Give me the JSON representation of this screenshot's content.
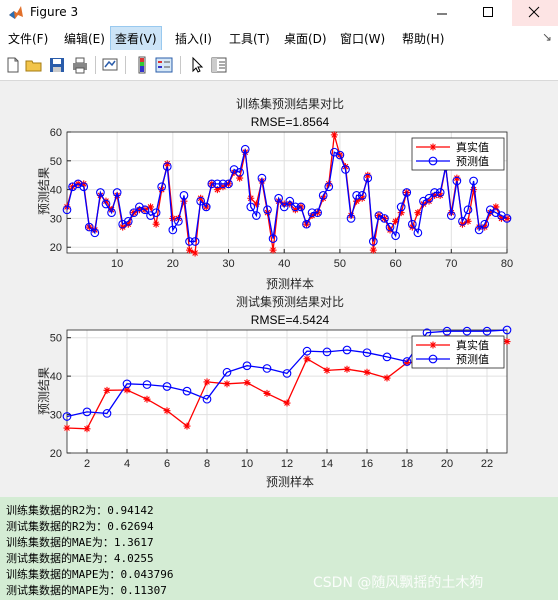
{
  "window": {
    "title": "Figure 3"
  },
  "menu": [
    "文件(F)",
    "编辑(E)",
    "查看(V)",
    "插入(I)",
    "工具(T)",
    "桌面(D)",
    "窗口(W)",
    "帮助(H)"
  ],
  "toolbar_icons": [
    "new-figure-icon",
    "open-file-icon",
    "save-icon",
    "print-icon",
    "link-plot-icon",
    "insert-colorbar-icon",
    "insert-legend-icon",
    "pointer-icon",
    "property-inspector-icon"
  ],
  "chart_data": [
    {
      "type": "line",
      "title": "训练集预测结果对比",
      "subtitle": "RMSE=1.8564",
      "xlabel": "预测样本",
      "ylabel": "预测结果",
      "xlim": [
        1,
        80
      ],
      "ylim": [
        18,
        60
      ],
      "xticks": [
        10,
        20,
        30,
        40,
        50,
        60,
        70,
        80
      ],
      "yticks": [
        20,
        30,
        40,
        50,
        60
      ],
      "grid": true,
      "legend_position": "top-right",
      "x": [
        1,
        2,
        3,
        4,
        5,
        6,
        7,
        8,
        9,
        10,
        11,
        12,
        13,
        14,
        15,
        16,
        17,
        18,
        19,
        20,
        21,
        22,
        23,
        24,
        25,
        26,
        27,
        28,
        29,
        30,
        31,
        32,
        33,
        34,
        35,
        36,
        37,
        38,
        39,
        40,
        41,
        42,
        43,
        44,
        45,
        46,
        47,
        48,
        49,
        50,
        51,
        52,
        53,
        54,
        55,
        56,
        57,
        58,
        59,
        60,
        61,
        62,
        63,
        64,
        65,
        66,
        67,
        68,
        69,
        70,
        71,
        72,
        73,
        74,
        75,
        76,
        77,
        78,
        79,
        80
      ],
      "series": [
        {
          "name": "真实值",
          "color": "#ff0000",
          "marker": "star",
          "values": [
            34,
            41,
            42,
            42,
            27,
            26,
            38,
            36,
            33,
            38,
            27,
            28,
            32,
            33,
            33,
            34,
            28,
            40,
            49,
            30,
            30,
            36,
            19,
            18,
            37,
            34,
            42,
            40,
            41,
            42,
            46,
            44,
            53,
            37,
            35,
            43,
            32,
            19,
            36,
            35,
            35,
            33,
            34,
            28,
            31,
            32,
            37,
            42,
            59,
            52,
            48,
            31,
            36,
            37,
            45,
            19,
            31,
            30,
            26,
            29,
            32,
            39,
            27,
            32,
            35,
            36,
            38,
            38,
            48,
            32,
            44,
            28,
            29,
            40,
            27,
            27,
            32,
            34,
            30,
            30
          ]
        },
        {
          "name": "预测值",
          "color": "#0000ff",
          "marker": "circle",
          "values": [
            33,
            41,
            42,
            41,
            27,
            25,
            39,
            35,
            32,
            39,
            28,
            29,
            32,
            34,
            33,
            31,
            32,
            41,
            48,
            26,
            29,
            38,
            22,
            22,
            36,
            34,
            42,
            42,
            42,
            42,
            47,
            46,
            54,
            34,
            31,
            44,
            33,
            23,
            37,
            34,
            36,
            34,
            34,
            28,
            32,
            32,
            38,
            41,
            53,
            52,
            47,
            30,
            38,
            38,
            44,
            22,
            31,
            30,
            27,
            24,
            34,
            39,
            28,
            25,
            36,
            37,
            39,
            39,
            48,
            31,
            43,
            29,
            33,
            43,
            26,
            28,
            33,
            32,
            31,
            30
          ]
        }
      ]
    },
    {
      "type": "line",
      "title": "测试集预测结果对比",
      "subtitle": "RMSE=4.5424",
      "xlabel": "预测样本",
      "ylabel": "预测结果",
      "xlim": [
        1,
        23
      ],
      "ylim": [
        20,
        52
      ],
      "xticks": [
        2,
        4,
        6,
        8,
        10,
        12,
        14,
        16,
        18,
        20,
        22
      ],
      "yticks": [
        20,
        30,
        40,
        50
      ],
      "grid": true,
      "legend_position": "top-right",
      "x": [
        1,
        2,
        3,
        4,
        5,
        6,
        7,
        8,
        9,
        10,
        11,
        12,
        13,
        14,
        15,
        16,
        17,
        18,
        19,
        20,
        21,
        22,
        23
      ],
      "series": [
        {
          "name": "真实值",
          "color": "#ff0000",
          "marker": "star",
          "values": [
            26.5,
            26.3,
            36.3,
            36.4,
            34,
            31,
            27,
            38.5,
            38,
            38.3,
            35.5,
            33,
            44.5,
            41.5,
            41.8,
            41,
            39.5,
            43.5,
            43.6,
            50,
            49,
            49.5,
            49
          ]
        },
        {
          "name": "预测值",
          "color": "#0000ff",
          "marker": "circle",
          "values": [
            29.5,
            30.7,
            30.3,
            38,
            37.8,
            37.3,
            36.1,
            34,
            41,
            42.7,
            42,
            40.7,
            46.5,
            46.3,
            46.8,
            46.1,
            45,
            43.8,
            51.3,
            51.7,
            51.7,
            51.7,
            52
          ]
        }
      ]
    }
  ],
  "console_lines": [
    "训练集数据的R2为：0.94142",
    "测试集数据的R2为：0.62694",
    "训练集数据的MAE为：1.3617",
    "测试集数据的MAE为：4.0255",
    "训练集数据的MAPE为：0.043796",
    "测试集数据的MAPE为：0.11307"
  ],
  "watermark": "CSDN @随风飘摇的土木狗"
}
